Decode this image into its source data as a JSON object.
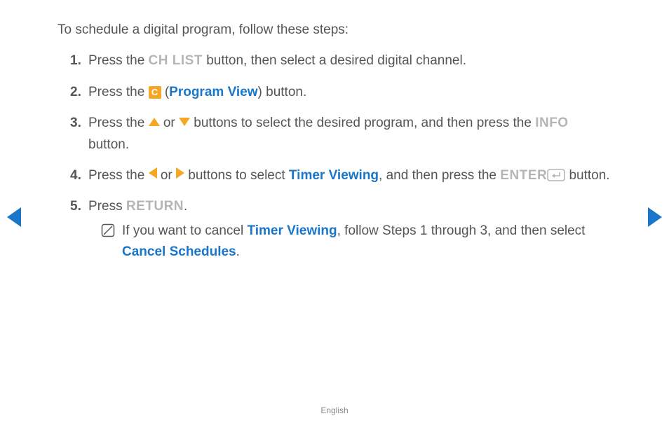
{
  "intro": "To schedule a digital program, follow these steps:",
  "steps": {
    "s1": {
      "num": "1.",
      "t1": "Press the ",
      "btn": "CH LIST",
      "t2": " button, then select a desired digital channel."
    },
    "s2": {
      "num": "2.",
      "t1": "Press the ",
      "badge": "C",
      "t2": " (",
      "link": "Program View",
      "t3": ") button."
    },
    "s3": {
      "num": "3.",
      "t1": "Press the ",
      "t2": " or ",
      "t3": " buttons to select the desired program, and then press the ",
      "btn": "INFO",
      "t4": " button."
    },
    "s4": {
      "num": "4.",
      "t1": "Press the ",
      "t2": " or ",
      "t3": " buttons to select ",
      "link": "Timer Viewing",
      "t4": ", and then press the ",
      "btn": "ENTER",
      "t5": " button."
    },
    "s5": {
      "num": "5.",
      "t1": "Press ",
      "btn": "RETURN",
      "t2": "."
    }
  },
  "note": {
    "t1": "If you want to cancel ",
    "link1": "Timer Viewing",
    "t2": ", follow Steps 1 through 3, and then select ",
    "link2": "Cancel Schedules",
    "t3": "."
  },
  "footer": "English"
}
